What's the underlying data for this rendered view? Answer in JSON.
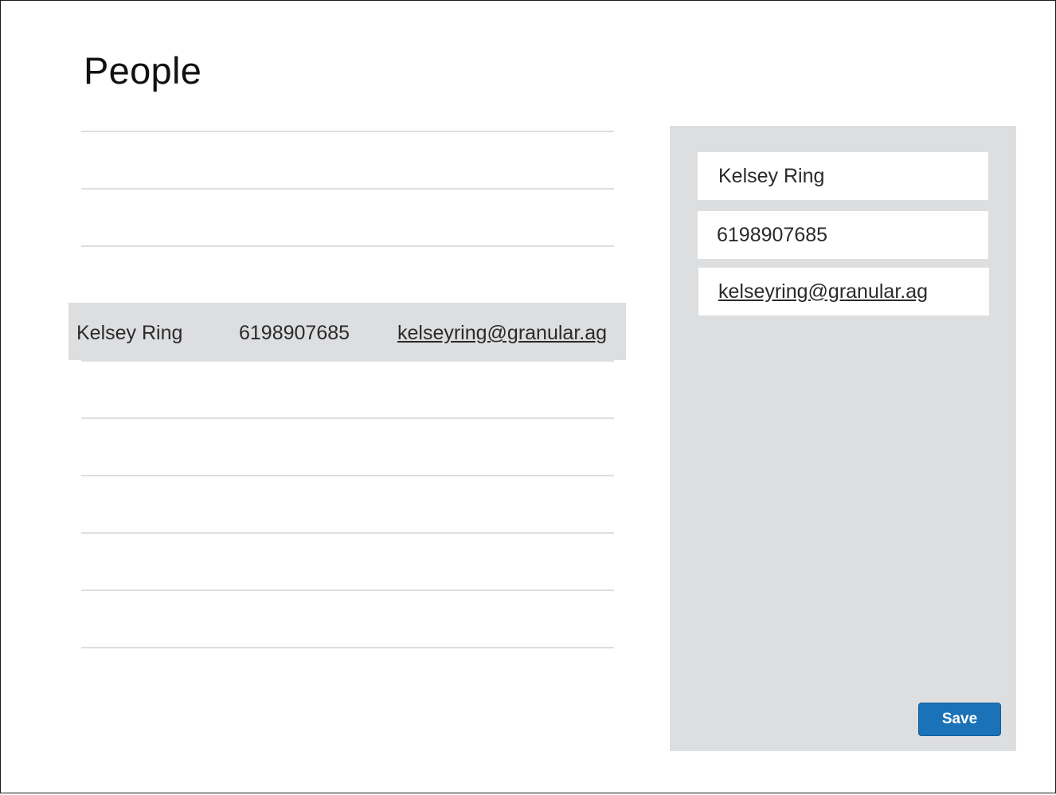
{
  "page": {
    "title": "People"
  },
  "list": {
    "selected_index": 3,
    "rows": [
      {
        "name": "",
        "phone": "",
        "email": ""
      },
      {
        "name": "",
        "phone": "",
        "email": ""
      },
      {
        "name": "",
        "phone": "",
        "email": ""
      },
      {
        "name": "Kelsey Ring",
        "phone": "6198907685",
        "email": "kelseyring@granular.ag"
      },
      {
        "name": "",
        "phone": "",
        "email": ""
      },
      {
        "name": "",
        "phone": "",
        "email": ""
      },
      {
        "name": "",
        "phone": "",
        "email": ""
      },
      {
        "name": "",
        "phone": "",
        "email": ""
      },
      {
        "name": "",
        "phone": "",
        "email": ""
      }
    ]
  },
  "detail": {
    "name_value": "Kelsey Ring",
    "phone_value": "6198907685",
    "email_value": "kelseyring@granular.ag",
    "save_label": "Save"
  },
  "colors": {
    "accent": "#1a72b8",
    "panel_bg": "#dddee0",
    "selected_row_bg": "#dddee0",
    "divider": "#dedede"
  }
}
